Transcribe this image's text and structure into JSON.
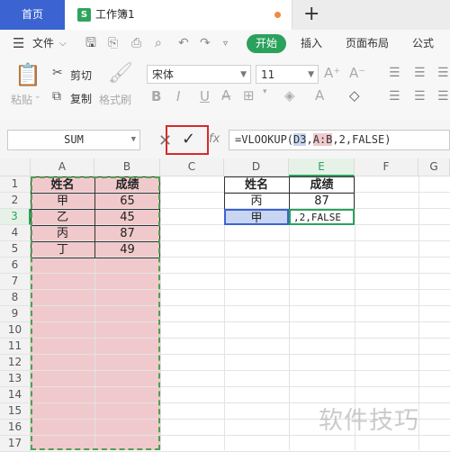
{
  "tabs": {
    "home": "首页",
    "doc_icon": "S",
    "doc_title": "工作簿1"
  },
  "toolbar": {
    "menu_icon": "hamburger-icon",
    "file_label": "文件",
    "start_label": "开始",
    "insert_label": "插入",
    "layout_label": "页面布局",
    "formula_label": "公式"
  },
  "ribbon": {
    "paste_label": "粘贴",
    "cut_label": "剪切",
    "copy_label": "复制",
    "format_painter_label": "格式刷",
    "font_name": "宋体",
    "font_size": "11",
    "grow_font": "A⁺",
    "shrink_font": "A⁻",
    "bold": "B",
    "italic": "I",
    "underline": "U"
  },
  "formula_bar": {
    "name_box": "SUM",
    "formula_start": "=VLOOKUP(",
    "formula_ref1": "D3",
    "formula_sep": ",",
    "formula_ref2": "A:B",
    "formula_end": ",2,FALSE)",
    "fx": "fx"
  },
  "grid": {
    "columns": [
      "A",
      "B",
      "C",
      "D",
      "E",
      "F",
      "G"
    ],
    "rows": [
      "1",
      "2",
      "3",
      "4",
      "5",
      "6",
      "7",
      "8",
      "9",
      "10",
      "11",
      "12",
      "13",
      "14",
      "15",
      "16",
      "17"
    ]
  },
  "table_ab": {
    "headers": [
      "姓名",
      "成绩"
    ],
    "rows": [
      [
        "甲",
        "65"
      ],
      [
        "乙",
        "45"
      ],
      [
        "丙",
        "87"
      ],
      [
        "丁",
        "49"
      ]
    ]
  },
  "table_de": {
    "headers": [
      "姓名",
      "成绩"
    ],
    "row2": [
      "丙",
      "87"
    ],
    "d3": "甲",
    "e3_edit": ",2,FALSE"
  },
  "watermark": "软件技巧",
  "colors": {
    "accent": "#3b63d1",
    "green": "#2aa25c",
    "ref_blue": "#c8d6f2",
    "ref_red": "#f0c9cc",
    "highlight": "#d62a2a"
  }
}
